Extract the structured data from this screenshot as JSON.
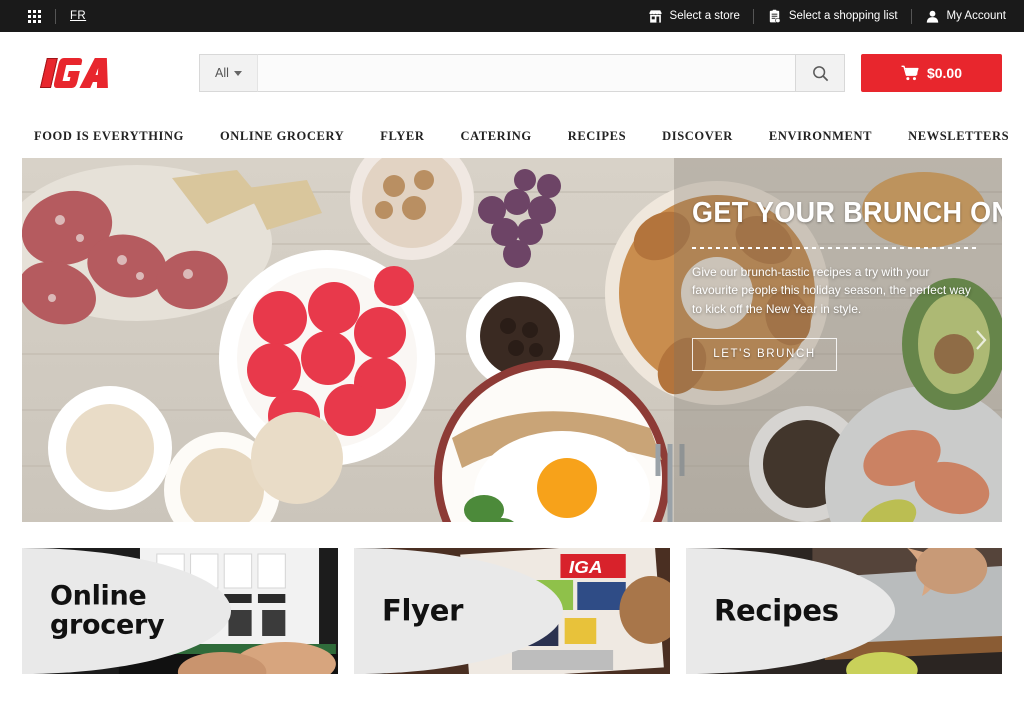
{
  "topbar": {
    "apps_icon": "grid-apps-icon",
    "language": "FR",
    "store": {
      "label": "Select a store",
      "icon": "store-icon"
    },
    "shopping_list": {
      "label": "Select a shopping list",
      "icon": "clipboard-list-icon"
    },
    "account": {
      "label": "My Account",
      "icon": "user-icon"
    }
  },
  "header": {
    "logo_text": "IGA",
    "logo_color": "#e8262d",
    "search": {
      "category_label": "All",
      "value": "",
      "placeholder": "",
      "button_icon": "search-icon"
    },
    "cart": {
      "amount": "$0.00",
      "icon": "shopping-cart-icon",
      "color": "#e8262d"
    }
  },
  "nav": {
    "items": [
      {
        "label": "FOOD IS EVERYTHING"
      },
      {
        "label": "ONLINE GROCERY"
      },
      {
        "label": "FLYER"
      },
      {
        "label": "CATERING"
      },
      {
        "label": "RECIPES"
      },
      {
        "label": "DISCOVER"
      },
      {
        "label": "ENVIRONMENT"
      },
      {
        "label": "NEWSLETTERS"
      }
    ]
  },
  "hero": {
    "title": "GET YOUR BRUNCH ON",
    "description": "Give our brunch-tastic recipes a try with your favourite people this holiday season, the perfect way to kick off the New Year in style.",
    "cta_label": "LET'S BRUNCH",
    "next_icon": "chevron-right-icon"
  },
  "cards": [
    {
      "label": "Online grocery",
      "line1": "Online",
      "line2": "grocery"
    },
    {
      "label": "Flyer",
      "line1": "Flyer",
      "line2": ""
    },
    {
      "label": "Recipes",
      "line1": "Recipes",
      "line2": ""
    }
  ]
}
